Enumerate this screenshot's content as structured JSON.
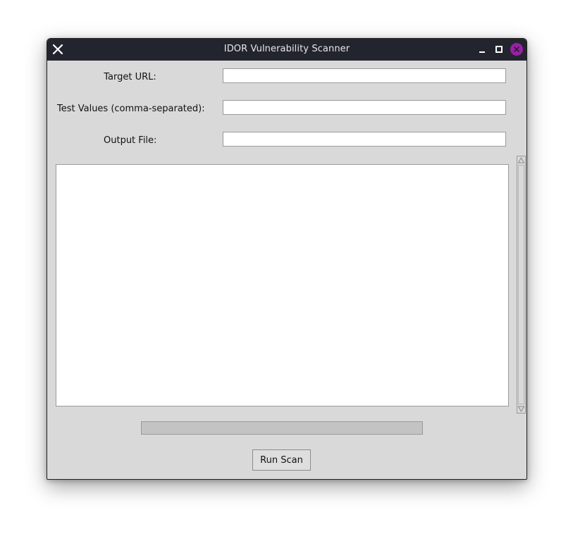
{
  "window": {
    "title": "IDOR Vulnerability Scanner"
  },
  "titlebar_icons": {
    "left": "close-x-icon",
    "minimize": "minimize-icon",
    "maximize": "maximize-icon",
    "close": "close-icon",
    "close_color": "#9b1fa8"
  },
  "form": {
    "target_url_label": "Target URL:",
    "target_url_value": "",
    "test_values_label": "Test Values (comma-separated):",
    "test_values_value": "",
    "output_file_label": "Output File:",
    "output_file_value": ""
  },
  "output": {
    "text": ""
  },
  "progress": {
    "value": 0
  },
  "actions": {
    "run_scan_label": "Run Scan"
  }
}
